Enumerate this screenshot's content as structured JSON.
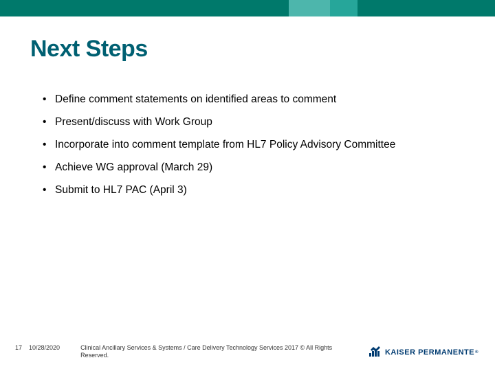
{
  "colors": {
    "accent": "#006072",
    "topbar": "#00796b",
    "logo": "#003b71"
  },
  "title": "Next Steps",
  "bullets": [
    "Define comment statements on identified areas to comment",
    "Present/discuss with Work Group",
    "Incorporate into comment template from HL7 Policy Advisory Committee",
    "Achieve WG approval (March 29)",
    "Submit to HL7 PAC (April 3)"
  ],
  "footer": {
    "page": "17",
    "date": "10/28/2020",
    "copyright": "Clinical Ancillary Services & Systems / Care Delivery Technology Services 2017 © All Rights Reserved."
  },
  "logo": {
    "text": "KAISER PERMANENTE",
    "reg": "®"
  }
}
